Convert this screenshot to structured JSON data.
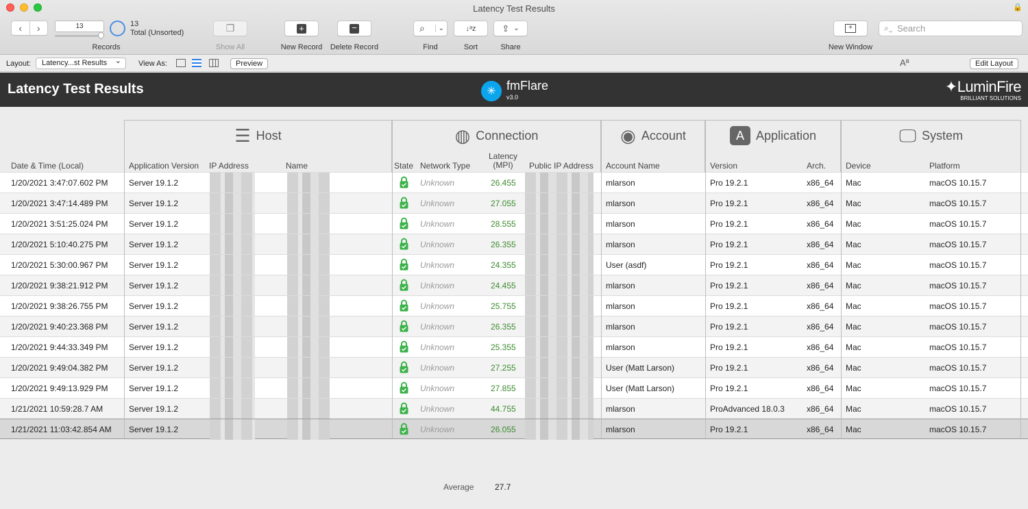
{
  "window": {
    "title": "Latency Test Results"
  },
  "toolbar": {
    "record_number": "13",
    "records_label": "Records",
    "found_count": "13",
    "found_label": "Total (Unsorted)",
    "show_all": "Show All",
    "new_record": "New Record",
    "delete_record": "Delete Record",
    "find": "Find",
    "sort": "Sort",
    "share": "Share",
    "new_window": "New Window",
    "search_placeholder": "Search"
  },
  "layoutbar": {
    "layout_label": "Layout:",
    "layout_value": "Latency...st Results",
    "view_as_label": "View As:",
    "preview": "Preview",
    "edit_layout": "Edit Layout"
  },
  "header": {
    "title": "Latency Test Results",
    "fm_name": "fmFlare",
    "fm_version": "v3.0",
    "brand": "LuminFire",
    "brand_tag": "BRILLIANT SOLUTIONS"
  },
  "groups": {
    "host": "Host",
    "connection": "Connection",
    "account": "Account",
    "application": "Application",
    "system": "System"
  },
  "columns": {
    "datetime": "Date & Time (Local)",
    "app_version": "Application Version",
    "ip": "IP Address",
    "name": "Name",
    "state": "State",
    "network_type": "Network Type",
    "latency_1": "Latency",
    "latency_2": "(MPI)",
    "public_ip": "Public IP Address",
    "account_name": "Account Name",
    "version": "Version",
    "arch": "Arch.",
    "device": "Device",
    "platform": "Platform"
  },
  "rows": [
    {
      "dt": "1/20/2021 3:47:07.602 PM",
      "appver": "Server 19.1.2",
      "net": "Unknown",
      "lat": "26.455",
      "acct": "mlarson",
      "ver": "Pro 19.2.1",
      "arch": "x86_64",
      "dev": "Mac",
      "plat": "macOS 10.15.7"
    },
    {
      "dt": "1/20/2021 3:47:14.489 PM",
      "appver": "Server 19.1.2",
      "net": "Unknown",
      "lat": "27.055",
      "acct": "mlarson",
      "ver": "Pro 19.2.1",
      "arch": "x86_64",
      "dev": "Mac",
      "plat": "macOS 10.15.7"
    },
    {
      "dt": "1/20/2021 3:51:25.024 PM",
      "appver": "Server 19.1.2",
      "net": "Unknown",
      "lat": "28.555",
      "acct": "mlarson",
      "ver": "Pro 19.2.1",
      "arch": "x86_64",
      "dev": "Mac",
      "plat": "macOS 10.15.7"
    },
    {
      "dt": "1/20/2021 5:10:40.275 PM",
      "appver": "Server 19.1.2",
      "net": "Unknown",
      "lat": "26.355",
      "acct": "mlarson",
      "ver": "Pro 19.2.1",
      "arch": "x86_64",
      "dev": "Mac",
      "plat": "macOS 10.15.7"
    },
    {
      "dt": "1/20/2021 5:30:00.967 PM",
      "appver": "Server 19.1.2",
      "net": "Unknown",
      "lat": "24.355",
      "acct": "User (asdf)",
      "ver": "Pro 19.2.1",
      "arch": "x86_64",
      "dev": "Mac",
      "plat": "macOS 10.15.7"
    },
    {
      "dt": "1/20/2021 9:38:21.912 PM",
      "appver": "Server 19.1.2",
      "net": "Unknown",
      "lat": "24.455",
      "acct": "mlarson",
      "ver": "Pro 19.2.1",
      "arch": "x86_64",
      "dev": "Mac",
      "plat": "macOS 10.15.7"
    },
    {
      "dt": "1/20/2021 9:38:26.755 PM",
      "appver": "Server 19.1.2",
      "net": "Unknown",
      "lat": "25.755",
      "acct": "mlarson",
      "ver": "Pro 19.2.1",
      "arch": "x86_64",
      "dev": "Mac",
      "plat": "macOS 10.15.7"
    },
    {
      "dt": "1/20/2021 9:40:23.368 PM",
      "appver": "Server 19.1.2",
      "net": "Unknown",
      "lat": "26.355",
      "acct": "mlarson",
      "ver": "Pro 19.2.1",
      "arch": "x86_64",
      "dev": "Mac",
      "plat": "macOS 10.15.7"
    },
    {
      "dt": "1/20/2021 9:44:33.349 PM",
      "appver": "Server 19.1.2",
      "net": "Unknown",
      "lat": "25.355",
      "acct": "mlarson",
      "ver": "Pro 19.2.1",
      "arch": "x86_64",
      "dev": "Mac",
      "plat": "macOS 10.15.7"
    },
    {
      "dt": "1/20/2021 9:49:04.382 PM",
      "appver": "Server 19.1.2",
      "net": "Unknown",
      "lat": "27.255",
      "acct": "User (Matt Larson)",
      "ver": "Pro 19.2.1",
      "arch": "x86_64",
      "dev": "Mac",
      "plat": "macOS 10.15.7"
    },
    {
      "dt": "1/20/2021 9:49:13.929 PM",
      "appver": "Server 19.1.2",
      "net": "Unknown",
      "lat": "27.855",
      "acct": "User (Matt Larson)",
      "ver": "Pro 19.2.1",
      "arch": "x86_64",
      "dev": "Mac",
      "plat": "macOS 10.15.7"
    },
    {
      "dt": "1/21/2021 10:59:28.7 AM",
      "appver": "Server 19.1.2",
      "net": "Unknown",
      "lat": "44.755",
      "acct": "mlarson",
      "ver": "ProAdvanced 18.0.3",
      "arch": "x86_64",
      "dev": "Mac",
      "plat": "macOS 10.15.7"
    },
    {
      "dt": "1/21/2021 11:03:42.854 AM",
      "appver": "Server 19.1.2",
      "net": "Unknown",
      "lat": "26.055",
      "acct": "mlarson",
      "ver": "Pro 19.2.1",
      "arch": "x86_64",
      "dev": "Mac",
      "plat": "macOS 10.15.7"
    }
  ],
  "selected_row": 12,
  "summary": {
    "label": "Average",
    "value": "27.7"
  },
  "colors": {
    "accent": "#2b7de9",
    "latency": "#3b8b2e",
    "lock": "#3cb24a",
    "header_bg": "#333333",
    "fm_blue": "#0ba5ee"
  }
}
